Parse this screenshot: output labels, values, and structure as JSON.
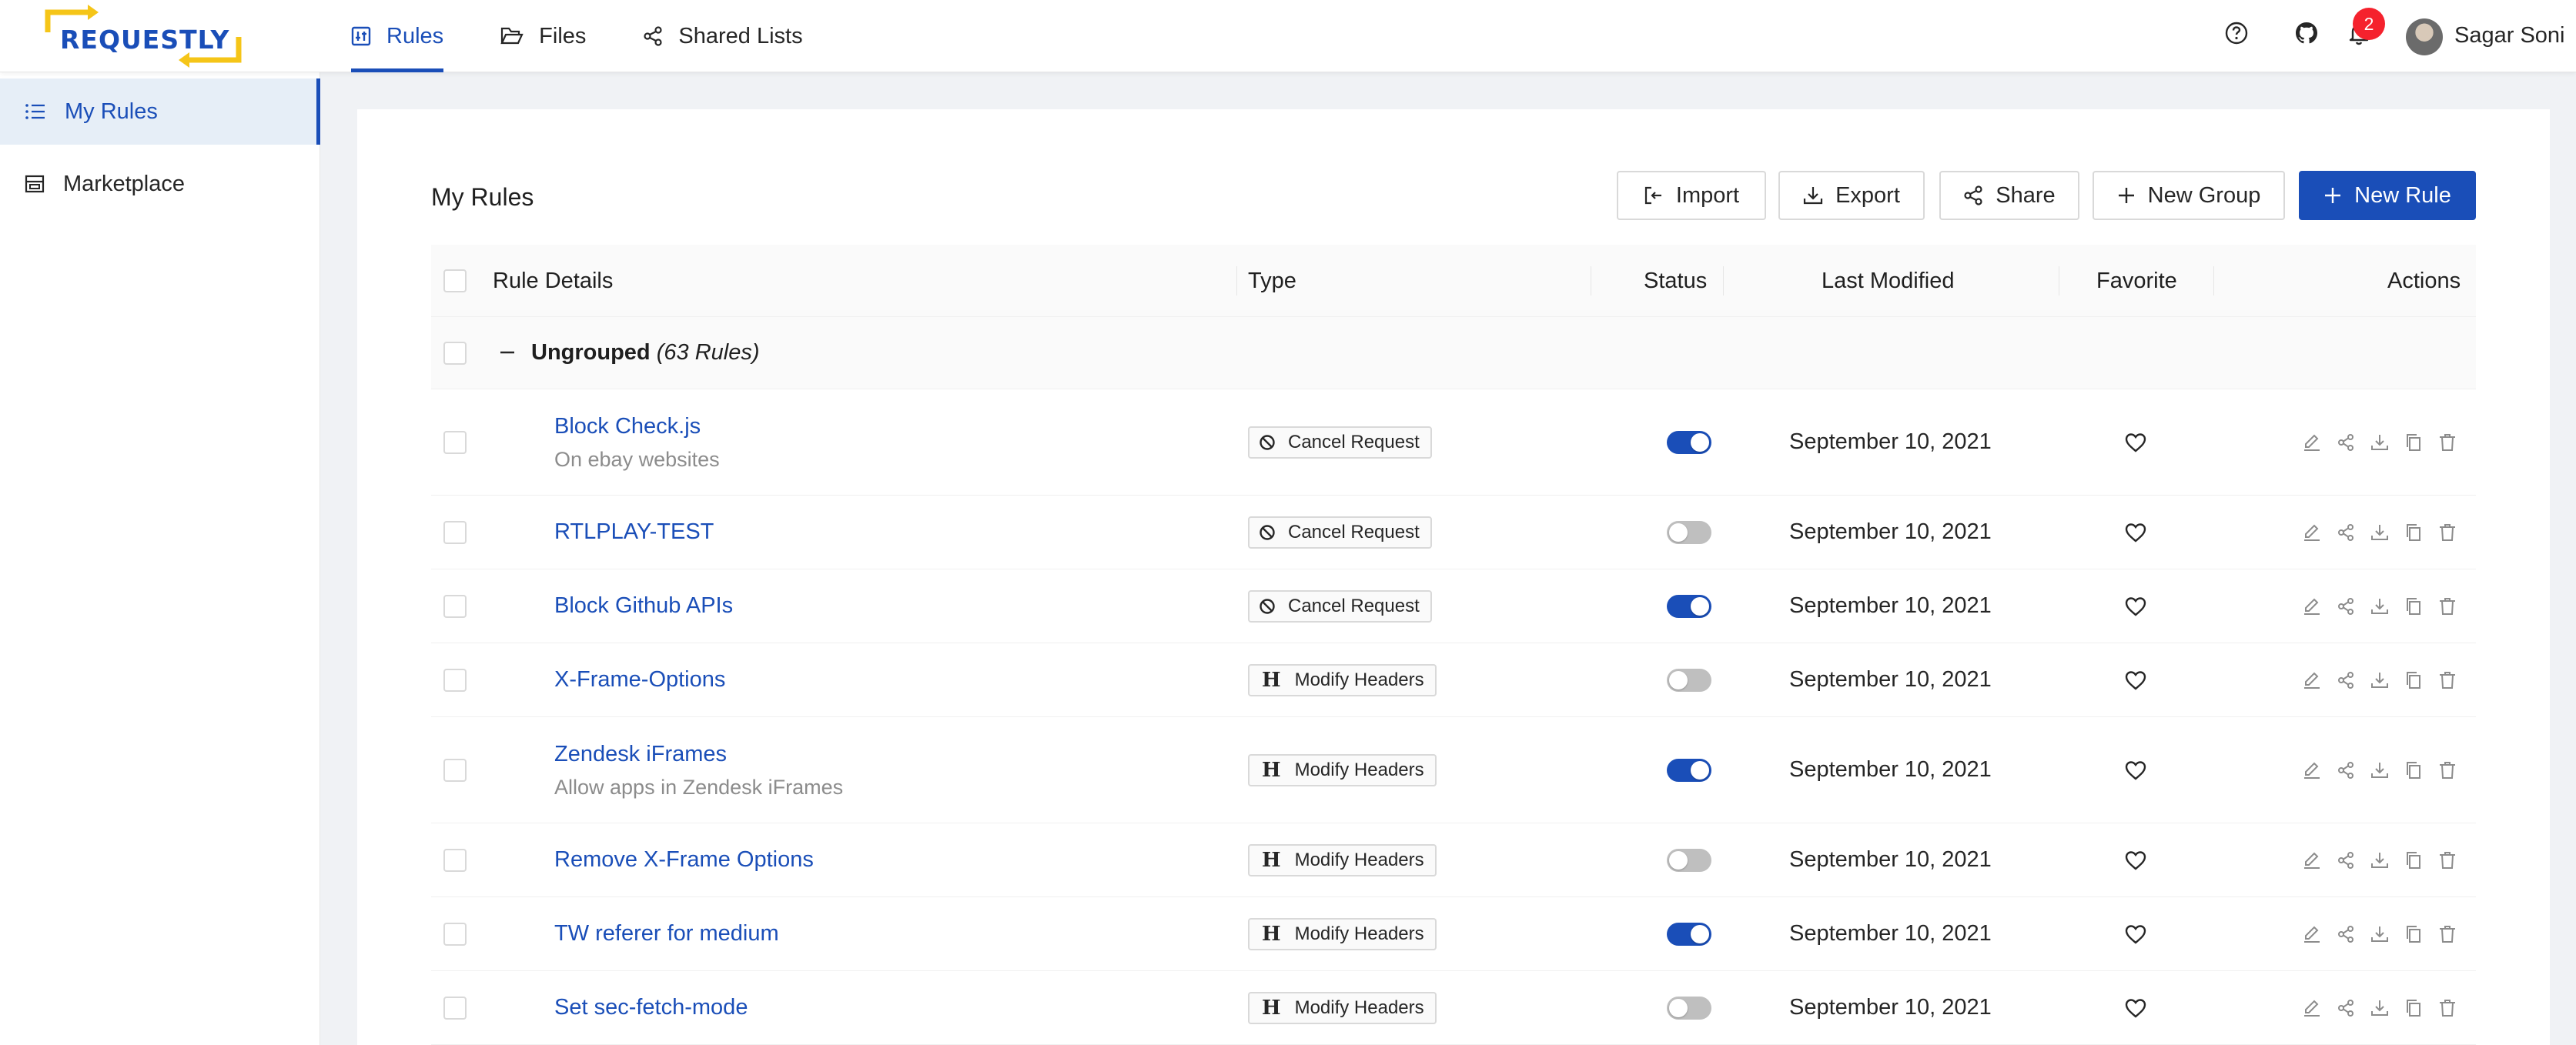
{
  "app": {
    "logo_text": "REQUESTLY",
    "colors": {
      "accent": "#1a4eb8",
      "logo_yellow": "#f5c518",
      "badge_red": "#f5222d"
    }
  },
  "nav": {
    "tabs": [
      {
        "label": "Rules",
        "icon": "sliders-icon",
        "active": true
      },
      {
        "label": "Files",
        "icon": "folder-open-icon",
        "active": false
      },
      {
        "label": "Shared Lists",
        "icon": "share-icon",
        "active": false
      }
    ]
  },
  "header": {
    "notification_count": "2",
    "user_name": "Sagar Soni",
    "icons": [
      "help-circle-icon",
      "github-icon",
      "bell-icon"
    ]
  },
  "sidebar": {
    "items": [
      {
        "label": "My Rules",
        "icon": "list-icon",
        "active": true
      },
      {
        "label": "Marketplace",
        "icon": "shop-icon",
        "active": false
      }
    ]
  },
  "main": {
    "title": "My Rules",
    "toolbar": {
      "import_label": "Import",
      "export_label": "Export",
      "share_label": "Share",
      "new_group_label": "New Group",
      "new_rule_label": "New Rule"
    },
    "table": {
      "columns": [
        "Rule Details",
        "Type",
        "Status",
        "Last Modified",
        "Favorite",
        "Actions"
      ],
      "group": {
        "name": "Ungrouped",
        "count": "(63 Rules)"
      },
      "rows": [
        {
          "name": "Block Check.js",
          "description": "On ebay websites",
          "type": "Cancel Request",
          "type_icon": "block-icon",
          "enabled": true,
          "modified": "September 10, 2021"
        },
        {
          "name": "RTLPLAY-TEST",
          "description": "",
          "type": "Cancel Request",
          "type_icon": "block-icon",
          "enabled": false,
          "modified": "September 10, 2021"
        },
        {
          "name": "Block Github APIs",
          "description": "",
          "type": "Cancel Request",
          "type_icon": "block-icon",
          "enabled": true,
          "modified": "September 10, 2021"
        },
        {
          "name": "X-Frame-Options",
          "description": "",
          "type": "Modify Headers",
          "type_icon": "header-h-icon",
          "enabled": false,
          "modified": "September 10, 2021"
        },
        {
          "name": "Zendesk iFrames",
          "description": "Allow apps in Zendesk iFrames",
          "type": "Modify Headers",
          "type_icon": "header-h-icon",
          "enabled": true,
          "modified": "September 10, 2021"
        },
        {
          "name": "Remove X-Frame Options",
          "description": "",
          "type": "Modify Headers",
          "type_icon": "header-h-icon",
          "enabled": false,
          "modified": "September 10, 2021"
        },
        {
          "name": "TW referer for medium",
          "description": "",
          "type": "Modify Headers",
          "type_icon": "header-h-icon",
          "enabled": true,
          "modified": "September 10, 2021"
        },
        {
          "name": "Set sec-fetch-mode",
          "description": "",
          "type": "Modify Headers",
          "type_icon": "header-h-icon",
          "enabled": false,
          "modified": "September 10, 2021"
        }
      ]
    }
  }
}
